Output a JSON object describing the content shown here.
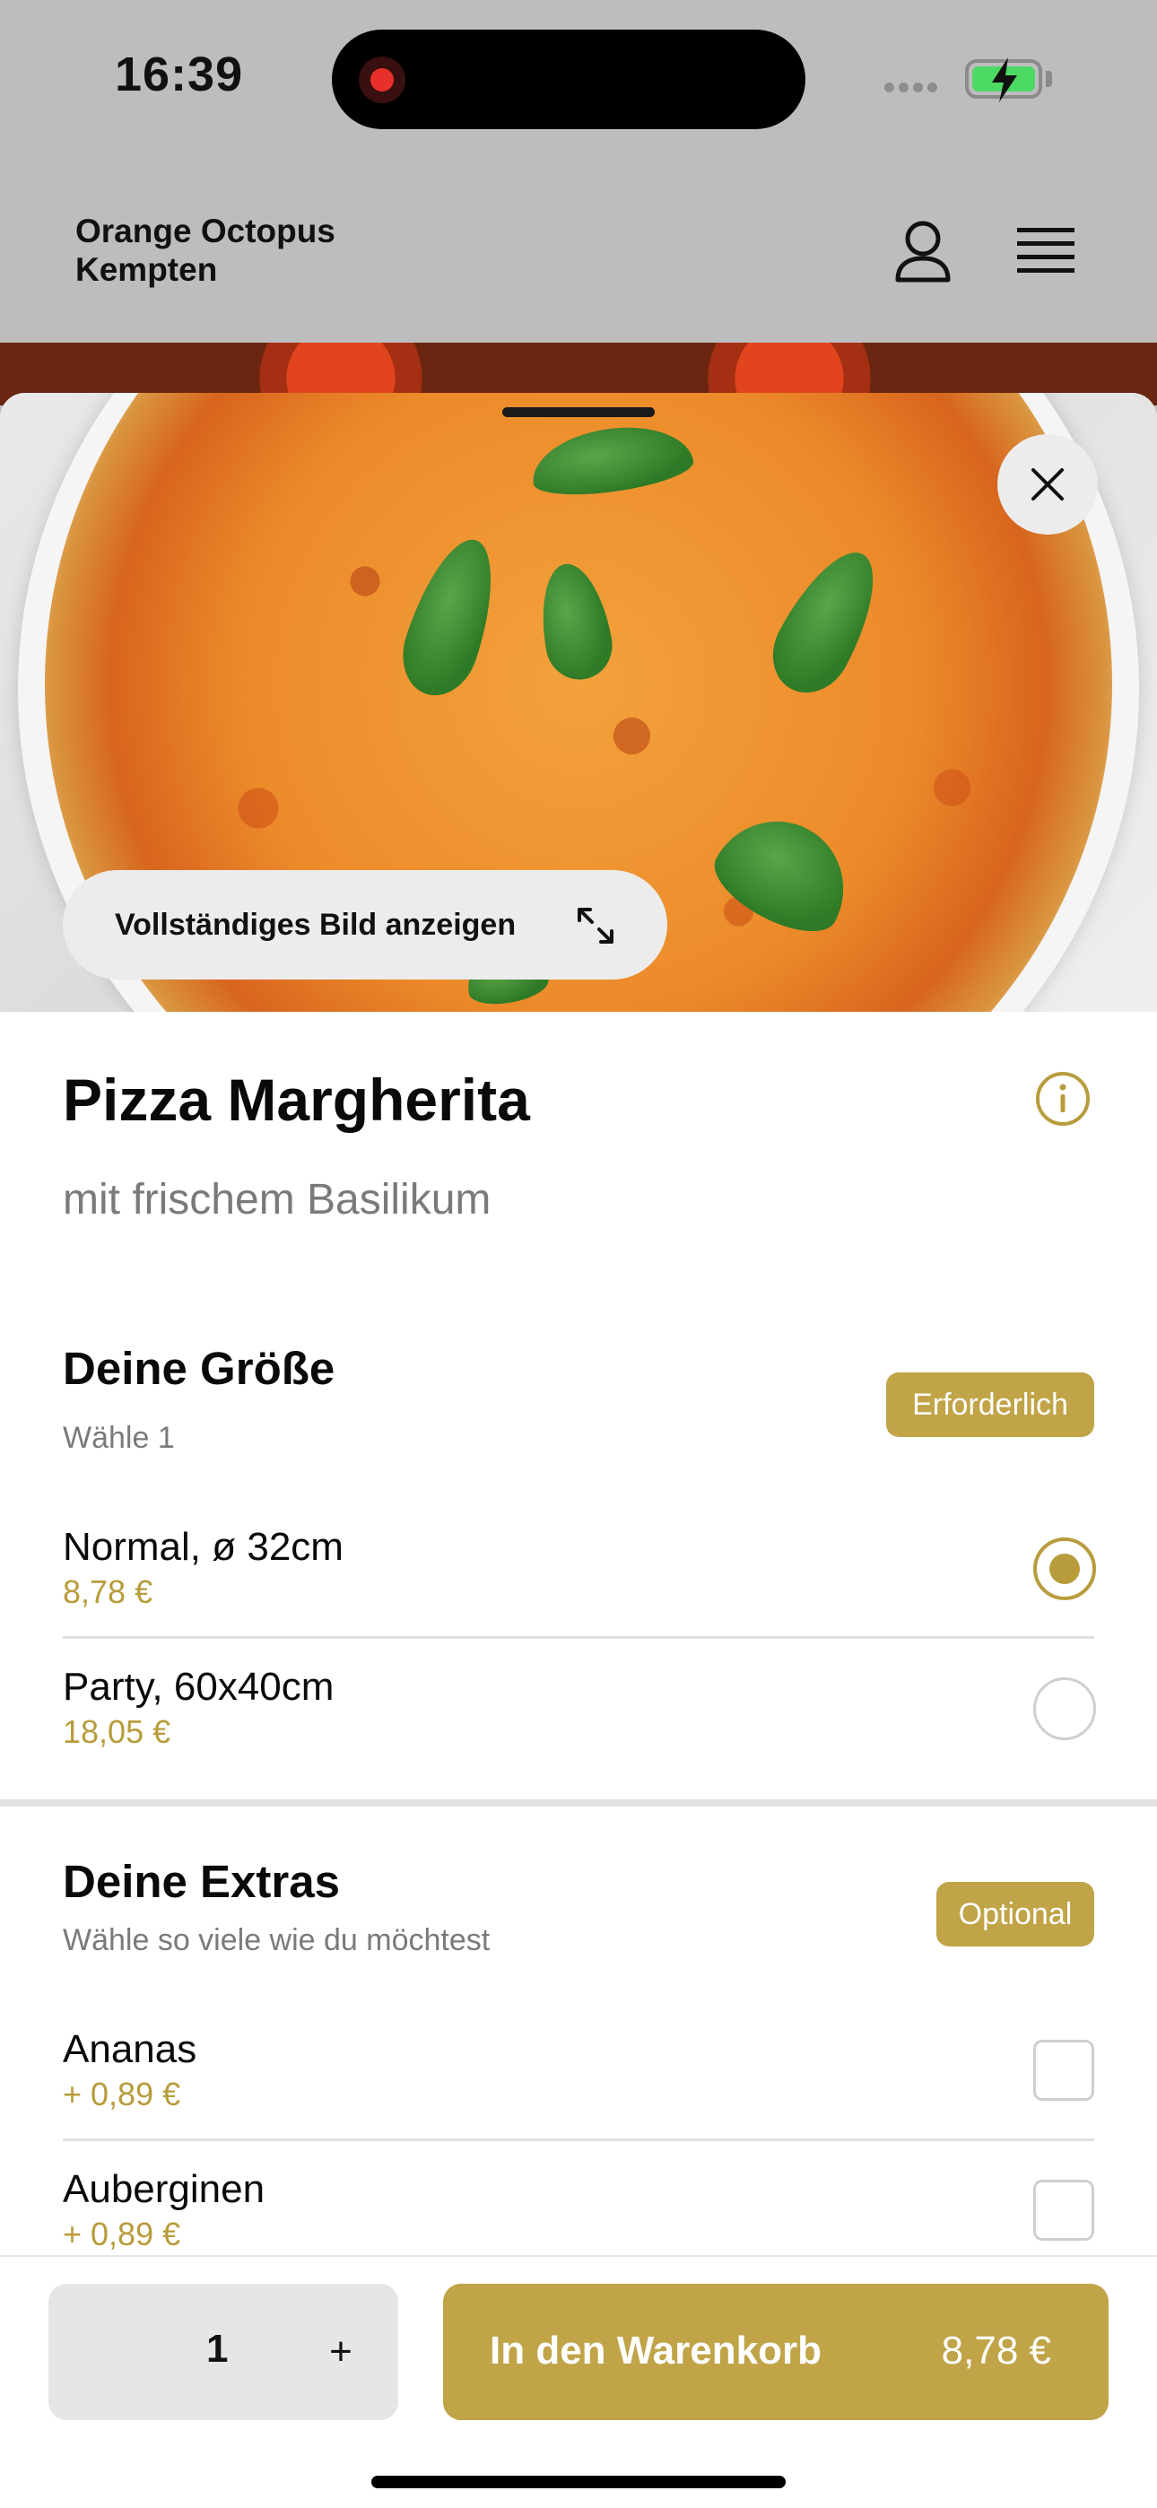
{
  "status_bar": {
    "time": "16:39"
  },
  "header": {
    "brand_line1": "Orange Octopus",
    "brand_line2": "Kempten"
  },
  "hero": {
    "view_full_image": "Vollständiges Bild anzeigen"
  },
  "product": {
    "title": "Pizza Margherita",
    "subtitle": "mit frischem Basilikum"
  },
  "size_section": {
    "title": "Deine Größe",
    "subtitle": "Wähle 1",
    "badge": "Erforderlich",
    "options": [
      {
        "name": "Normal, ø 32cm",
        "price": "8,78 €",
        "selected": true
      },
      {
        "name": "Party, 60x40cm",
        "price": "18,05 €",
        "selected": false
      }
    ]
  },
  "extras_section": {
    "title": "Deine Extras",
    "subtitle": "Wähle so viele wie du möchtest",
    "badge": "Optional",
    "options": [
      {
        "name": "Ananas",
        "price": "+ 0,89 €",
        "checked": false
      },
      {
        "name": "Auberginen",
        "price": "+ 0,89 €",
        "checked": false
      }
    ]
  },
  "bottom_bar": {
    "quantity": "1",
    "plus": "+",
    "cart_label": "In den Warenkorb",
    "cart_price": "8,78 €"
  },
  "colors": {
    "accent": "#c0a447",
    "price": "#b89c3c",
    "header_bg": "#bdbdbd"
  }
}
